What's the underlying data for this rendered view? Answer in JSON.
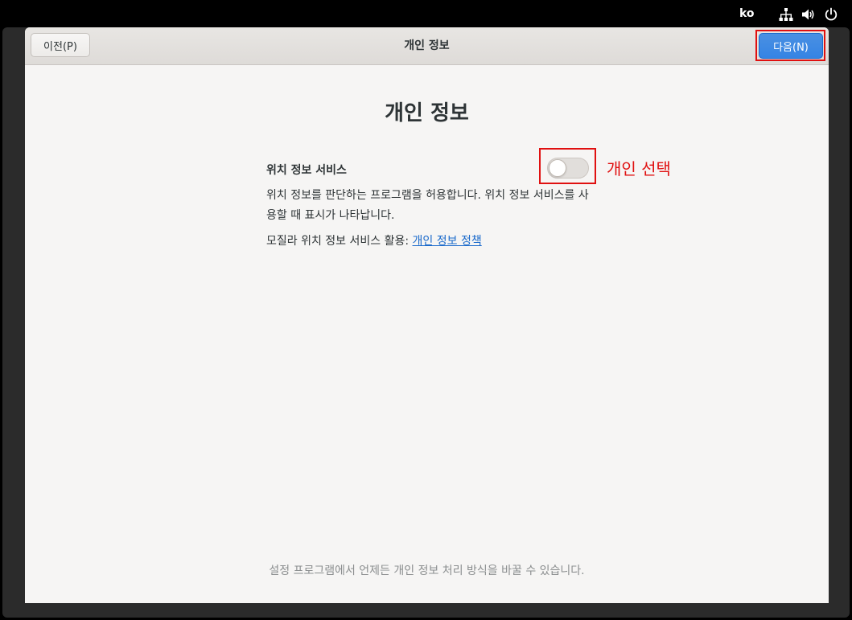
{
  "system_bar": {
    "language": "ko",
    "icons": [
      "network-icon",
      "volume-icon",
      "power-icon"
    ]
  },
  "header": {
    "prev_label": "이전(P)",
    "title": "개인 정보",
    "next_label": "다음(N)"
  },
  "main": {
    "heading": "개인 정보",
    "location_label": "위치 정보 서비스",
    "location_enabled": false,
    "description": "위치 정보를 판단하는 프로그램을 허용합니다. 위치 정보 서비스를 사용할 때 표시가 나타납니다.",
    "mozilla_prefix": "모질라 위치 정보 서비스 활용: ",
    "policy_link": "개인 정보 정책",
    "annotation": "개인 선택",
    "footer": "설정 프로그램에서 언제든 개인 정보 처리 방식을 바꿀 수 있습니다."
  },
  "colors": {
    "accent": "#3584e4",
    "highlight": "#e01010",
    "background": "#f6f5f4"
  }
}
